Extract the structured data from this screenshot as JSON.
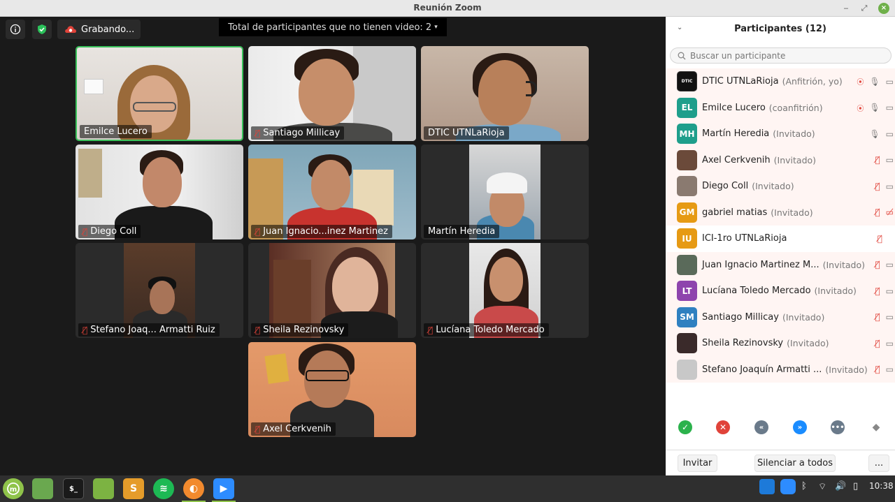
{
  "window": {
    "title": "Reunión Zoom"
  },
  "meeting": {
    "recording_label": "Grabando...",
    "no_video_banner": "Total de participantes que no tienen video: 2"
  },
  "tiles": [
    {
      "name": "Emilce Lucero",
      "muted": false
    },
    {
      "name": "Santiago Millicay",
      "muted": true
    },
    {
      "name": "DTIC UTNLaRioja",
      "muted": false
    },
    {
      "name": "Diego Coll",
      "muted": true
    },
    {
      "name": "Juan Ignacio...inez Martinez",
      "muted": true
    },
    {
      "name": "Martín Heredia",
      "muted": false
    },
    {
      "name": "Stefano Joaq... Armatti Ruiz",
      "muted": true
    },
    {
      "name": "Sheila Rezinovsky",
      "muted": true
    },
    {
      "name": "Lucíana Toledo Mercado",
      "muted": true
    },
    {
      "name": "Axel Cerkvenih",
      "muted": true
    }
  ],
  "panel": {
    "title": "Participantes (12)",
    "search_placeholder": "Buscar un participante",
    "participants": [
      {
        "initials": "",
        "name": "DTIC UTNLaRioja",
        "role": "(Anfitrión, yo)",
        "color": "#111111"
      },
      {
        "initials": "EL",
        "name": "Emilce Lucero",
        "role": "(coanfitrión)",
        "color": "#1e9e8b"
      },
      {
        "initials": "MH",
        "name": "Martín Heredia",
        "role": "(Invitado)",
        "color": "#1e9e8b"
      },
      {
        "initials": "",
        "name": "Axel Cerkvenih",
        "role": "(Invitado)",
        "color": "#6b4a3a"
      },
      {
        "initials": "",
        "name": "Diego Coll",
        "role": "(Invitado)",
        "color": "#8a7a70"
      },
      {
        "initials": "GM",
        "name": "gabriel matias",
        "role": "(Invitado)",
        "color": "#e69a14"
      },
      {
        "initials": "IU",
        "name": "ICI-1ro UTNLaRioja",
        "role": "",
        "color": "#e69a14"
      },
      {
        "initials": "",
        "name": "Juan Ignacio Martinez M...",
        "role": "(Invitado)",
        "color": "#5a6a5a"
      },
      {
        "initials": "LT",
        "name": "Lucíana Toledo Mercado",
        "role": "(Invitado)",
        "color": "#8e44ad"
      },
      {
        "initials": "SM",
        "name": "Santiago Millicay",
        "role": "(Invitado)",
        "color": "#2f80c0"
      },
      {
        "initials": "",
        "name": "Sheila Rezinovsky",
        "role": "(Invitado)",
        "color": "#3a2a2a"
      },
      {
        "initials": "",
        "name": "Stefano Joaquín Armatti ...",
        "role": "(Invitado)",
        "color": "#c8c8c8"
      }
    ],
    "invite_label": "Invitar",
    "mute_all_label": "Silenciar a todos",
    "more_label": "..."
  },
  "taskbar": {
    "clock": "10:38"
  }
}
